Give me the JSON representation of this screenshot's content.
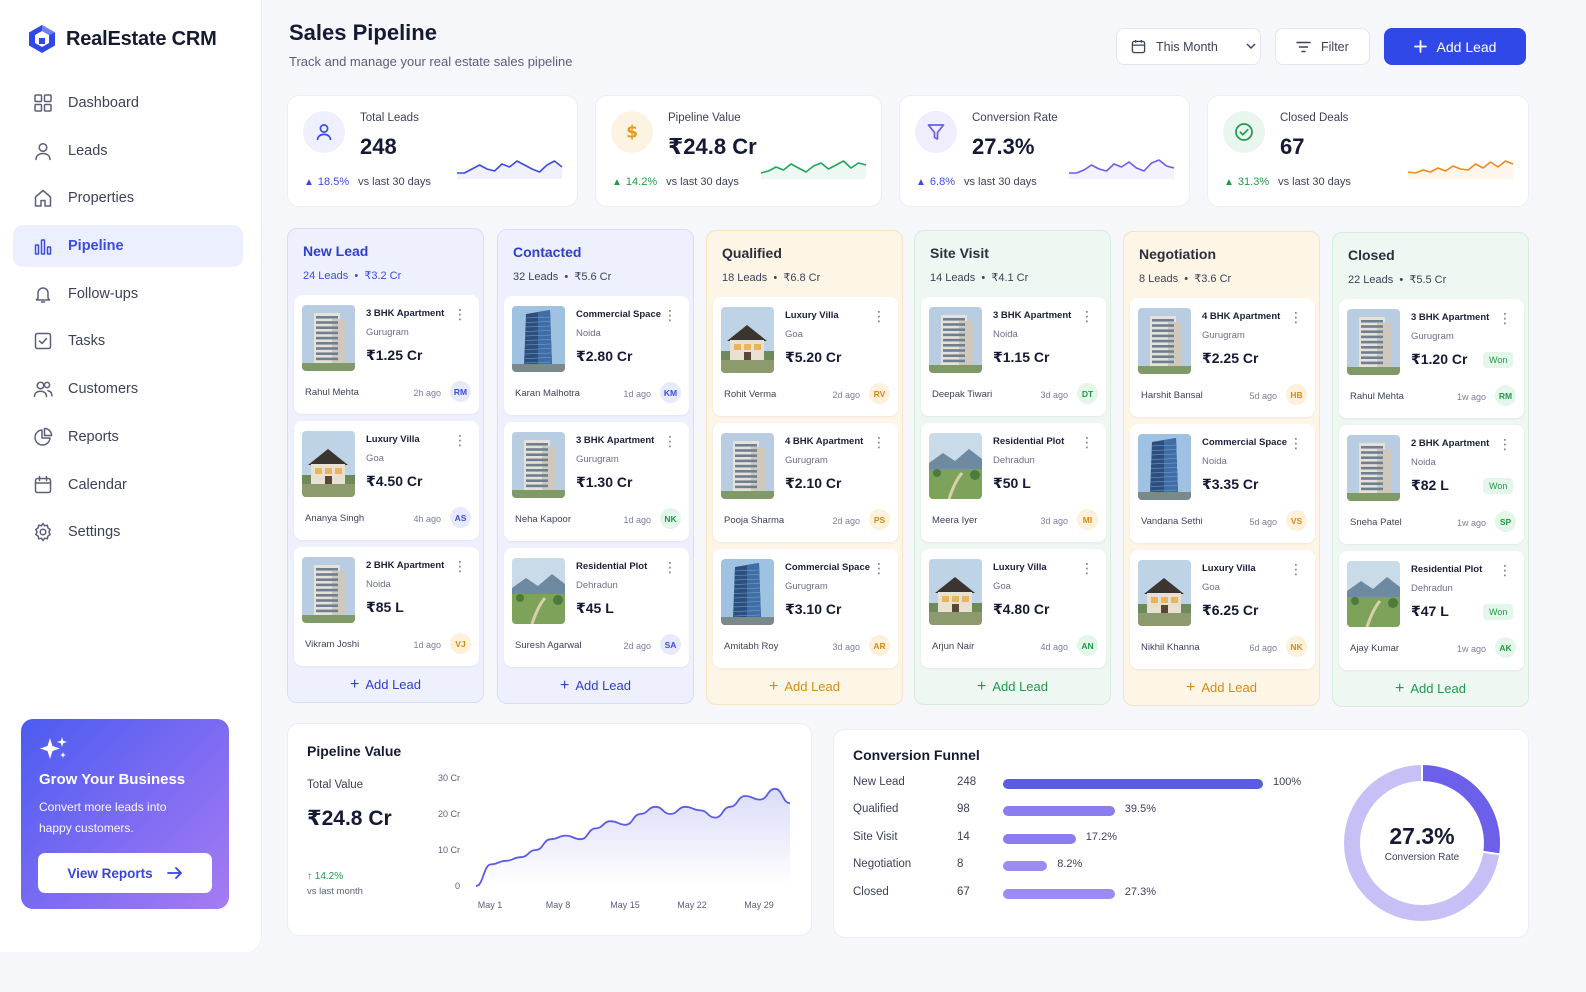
{
  "app": {
    "name": "RealEstate CRM"
  },
  "nav": [
    {
      "label": "Dashboard",
      "icon": "grid-icon"
    },
    {
      "label": "Leads",
      "icon": "user-icon"
    },
    {
      "label": "Properties",
      "icon": "home-icon"
    },
    {
      "label": "Pipeline",
      "icon": "bar-chart-icon",
      "active": true
    },
    {
      "label": "Follow-ups",
      "icon": "bell-icon"
    },
    {
      "label": "Tasks",
      "icon": "checkbox-icon"
    },
    {
      "label": "Customers",
      "icon": "users-icon"
    },
    {
      "label": "Reports",
      "icon": "pie-chart-icon"
    },
    {
      "label": "Calendar",
      "icon": "calendar-icon"
    },
    {
      "label": "Settings",
      "icon": "gear-icon"
    }
  ],
  "promo": {
    "title": "Grow Your Business",
    "text": "Convert more leads into happy customers.",
    "button": "View Reports"
  },
  "header": {
    "title": "Sales Pipeline",
    "subtitle": "Track and manage your real estate sales pipeline",
    "period": "This Month",
    "filter": "Filter",
    "add_lead": "Add Lead"
  },
  "stats": [
    {
      "label": "Total Leads",
      "value": "248",
      "change": "18.5%",
      "compare": "vs last 30 days",
      "color": "#3b4ce0",
      "bg": "#eef0fd",
      "icon": "user-icon"
    },
    {
      "label": "Pipeline Value",
      "value": "₹24.8 Cr",
      "change": "14.2%",
      "compare": "vs last 30 days",
      "color": "#22a55a",
      "bg": "#fdf3e2",
      "icon": "rupee-icon"
    },
    {
      "label": "Conversion Rate",
      "value": "27.3%",
      "change": "6.8%",
      "compare": "vs last 30 days",
      "color": "#6a5cf0",
      "bg": "#f0eefd",
      "icon": "funnel-icon"
    },
    {
      "label": "Closed Deals",
      "value": "67",
      "change": "31.3%",
      "compare": "vs last 30 days",
      "color": "#f08a1c",
      "bg": "#e8f6ee",
      "icon": "check-circle-icon"
    }
  ],
  "columns": [
    {
      "name": "New Lead",
      "meta": "24 Leads  •  ₹3.2 Cr",
      "theme": {
        "bg": "#eef1fd",
        "border": "#d7ddf8",
        "title": "#2e3fc8",
        "meta": "#3b4ce0",
        "add": "#2e3fc8"
      },
      "cards": [
        {
          "title": "3 BHK Apartment",
          "location": "Gurugram",
          "price": "₹1.25 Cr",
          "agent": "Rahul Mehta",
          "time": "2h ago",
          "initials": "RM",
          "av_bg": "#e7eafd",
          "av_fg": "#3b4ce0",
          "img": "tower"
        },
        {
          "title": "Luxury Villa",
          "location": "Goa",
          "price": "₹4.50 Cr",
          "agent": "Ananya Singh",
          "time": "4h ago",
          "initials": "AS",
          "av_bg": "#e7eafd",
          "av_fg": "#3b4ce0",
          "img": "villa"
        },
        {
          "title": "2 BHK Apartment",
          "location": "Noida",
          "price": "₹85 L",
          "agent": "Vikram Joshi",
          "time": "1d ago",
          "initials": "VJ",
          "av_bg": "#fdf1dc",
          "av_fg": "#d98a16",
          "img": "tower"
        }
      ]
    },
    {
      "name": "Contacted",
      "meta": "32 Leads  •  ₹5.6 Cr",
      "theme": {
        "bg": "#eef1fd",
        "border": "#d7ddf8",
        "title": "#2e3fc8",
        "meta": "#3c4258",
        "add": "#2e3fc8"
      },
      "cards": [
        {
          "title": "Commercial Space",
          "location": "Noida",
          "price": "₹2.80 Cr",
          "agent": "Karan Malhotra",
          "time": "1d ago",
          "initials": "KM",
          "av_bg": "#e7eafd",
          "av_fg": "#3b4ce0",
          "img": "glass"
        },
        {
          "title": "3 BHK Apartment",
          "location": "Gurugram",
          "price": "₹1.30 Cr",
          "agent": "Neha Kapoor",
          "time": "1d ago",
          "initials": "NK",
          "av_bg": "#e4f6ea",
          "av_fg": "#1f9a4a",
          "img": "tower"
        },
        {
          "title": "Residential Plot",
          "location": "Dehradun",
          "price": "₹45 L",
          "agent": "Suresh Agarwal",
          "time": "2d ago",
          "initials": "SA",
          "av_bg": "#e7eafd",
          "av_fg": "#3b4ce0",
          "img": "plot"
        }
      ]
    },
    {
      "name": "Qualified",
      "meta": "18 Leads  •  ₹6.8 Cr",
      "theme": {
        "bg": "#fdf5e6",
        "border": "#f6e4c2",
        "title": "#2c2f3d",
        "meta": "#3c4258",
        "add": "#d98a16"
      },
      "cards": [
        {
          "title": "Luxury Villa",
          "location": "Goa",
          "price": "₹5.20 Cr",
          "agent": "Rohit Verma",
          "time": "2d ago",
          "initials": "RV",
          "av_bg": "#fdf1dc",
          "av_fg": "#d98a16",
          "img": "villa"
        },
        {
          "title": "4 BHK Apartment",
          "location": "Gurugram",
          "price": "₹2.10 Cr",
          "agent": "Pooja Sharma",
          "time": "2d ago",
          "initials": "PS",
          "av_bg": "#fdf1dc",
          "av_fg": "#d98a16",
          "img": "tower"
        },
        {
          "title": "Commercial Space",
          "location": "Gurugram",
          "price": "₹3.10 Cr",
          "agent": "Amitabh Roy",
          "time": "3d ago",
          "initials": "AR",
          "av_bg": "#fdf1dc",
          "av_fg": "#d98a16",
          "img": "glass"
        }
      ]
    },
    {
      "name": "Site Visit",
      "meta": "14 Leads  •  ₹4.1 Cr",
      "theme": {
        "bg": "#eef7f1",
        "border": "#d5ecdc",
        "title": "#2c2f3d",
        "meta": "#3c4258",
        "add": "#1f9a4a"
      },
      "cards": [
        {
          "title": "3 BHK Apartment",
          "location": "Noida",
          "price": "₹1.15 Cr",
          "agent": "Deepak Tiwari",
          "time": "3d ago",
          "initials": "DT",
          "av_bg": "#e4f6ea",
          "av_fg": "#1f9a4a",
          "img": "tower"
        },
        {
          "title": "Residential Plot",
          "location": "Dehradun",
          "price": "₹50 L",
          "agent": "Meera Iyer",
          "time": "3d ago",
          "initials": "MI",
          "av_bg": "#fdf1dc",
          "av_fg": "#d98a16",
          "img": "plot"
        },
        {
          "title": "Luxury Villa",
          "location": "Goa",
          "price": "₹4.80 Cr",
          "agent": "Arjun Nair",
          "time": "4d ago",
          "initials": "AN",
          "av_bg": "#e4f6ea",
          "av_fg": "#1f9a4a",
          "img": "villa"
        }
      ]
    },
    {
      "name": "Negotiation",
      "meta": "8 Leads  •  ₹3.6 Cr",
      "theme": {
        "bg": "#fdf5e6",
        "border": "#f6e4c2",
        "title": "#2c2f3d",
        "meta": "#3c4258",
        "add": "#d98a16"
      },
      "cards": [
        {
          "title": "4 BHK Apartment",
          "location": "Gurugram",
          "price": "₹2.25 Cr",
          "agent": "Harshit Bansal",
          "time": "5d ago",
          "initials": "HB",
          "av_bg": "#fdf1dc",
          "av_fg": "#d98a16",
          "img": "tower"
        },
        {
          "title": "Commercial Space",
          "location": "Noida",
          "price": "₹3.35 Cr",
          "agent": "Vandana Sethi",
          "time": "5d ago",
          "initials": "VS",
          "av_bg": "#fdf1dc",
          "av_fg": "#d98a16",
          "img": "glass"
        },
        {
          "title": "Luxury Villa",
          "location": "Goa",
          "price": "₹6.25 Cr",
          "agent": "Nikhil Khanna",
          "time": "6d ago",
          "initials": "NK",
          "av_bg": "#fdf1dc",
          "av_fg": "#d98a16",
          "img": "villa"
        }
      ]
    },
    {
      "name": "Closed",
      "meta": "22 Leads  •  ₹5.5 Cr",
      "theme": {
        "bg": "#eef7f1",
        "border": "#d5ecdc",
        "title": "#2c2f3d",
        "meta": "#3c4258",
        "add": "#1f9a4a"
      },
      "cards": [
        {
          "title": "3 BHK Apartment",
          "location": "Gurugram",
          "price": "₹1.20 Cr",
          "badge": "Won",
          "agent": "Rahul Mehta",
          "time": "1w ago",
          "initials": "RM",
          "av_bg": "#e4f6ea",
          "av_fg": "#1f9a4a",
          "img": "tower"
        },
        {
          "title": "2 BHK Apartment",
          "location": "Noida",
          "price": "₹82 L",
          "badge": "Won",
          "agent": "Sneha Patel",
          "time": "1w ago",
          "initials": "SP",
          "av_bg": "#e4f6ea",
          "av_fg": "#1f9a4a",
          "img": "tower"
        },
        {
          "title": "Residential Plot",
          "location": "Dehradun",
          "price": "₹47 L",
          "badge": "Won",
          "agent": "Ajay Kumar",
          "time": "1w ago",
          "initials": "AK",
          "av_bg": "#e4f6ea",
          "av_fg": "#1f9a4a",
          "img": "plot"
        }
      ]
    }
  ],
  "add_lead_label": "Add Lead",
  "pipeline_value": {
    "title": "Pipeline Value",
    "label": "Total Value",
    "value": "₹24.8 Cr",
    "change": "14.2%",
    "compare": "vs last month"
  },
  "chart_data": {
    "type": "area",
    "x": [
      "May 1",
      "May 8",
      "May 15",
      "May 22",
      "May 29"
    ],
    "y_ticks": [
      "0",
      "10 Cr",
      "20 Cr",
      "30 Cr"
    ],
    "ylim": [
      0,
      30
    ],
    "points": [
      0,
      6,
      7,
      8,
      10,
      13,
      14,
      13,
      16,
      18,
      17,
      20,
      22,
      20,
      22,
      21,
      19,
      22,
      25,
      24,
      27,
      23
    ],
    "color": "#5b5ce6"
  },
  "funnel": {
    "title": "Conversion Funnel",
    "rows": [
      {
        "label": "New Lead",
        "count": "248",
        "pct": "100%",
        "frac": 1.0,
        "color": "#5a5ce4"
      },
      {
        "label": "Qualified",
        "count": "98",
        "pct": "39.5%",
        "frac": 0.43,
        "color": "#8b7cf0"
      },
      {
        "label": "Site Visit",
        "count": "14",
        "pct": "17.2%",
        "frac": 0.28,
        "color": "#8b7cf0"
      },
      {
        "label": "Negotiation",
        "count": "8",
        "pct": "8.2%",
        "frac": 0.17,
        "color": "#9b8cf3"
      },
      {
        "label": "Closed",
        "count": "67",
        "pct": "27.3%",
        "frac": 0.43,
        "color": "#9b8cf3"
      }
    ],
    "donut_value": "27.3%",
    "donut_label": "Conversion Rate",
    "donut_fraction": 0.273
  }
}
